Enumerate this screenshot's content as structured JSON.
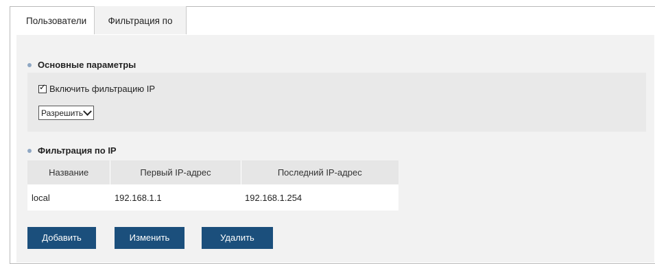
{
  "tabs": [
    {
      "label": "Пользователи"
    },
    {
      "label": "Фильтрация по IP"
    }
  ],
  "basic": {
    "title": "Основные параметры",
    "enable_label": "Включить фильтрацию IP",
    "enable_checked": true,
    "mode_value": "Разрешить"
  },
  "ip_filter": {
    "title": "Фильтрация по IP",
    "columns": [
      "Название",
      "Первый IP-адрес",
      "Последний IP-адрес"
    ],
    "rows": [
      {
        "name": "local",
        "first": "192.168.1.1",
        "last": "192.168.1.254"
      }
    ]
  },
  "buttons": {
    "add": "Добавить",
    "edit": "Изменить",
    "delete": "Удалить"
  },
  "colors": {
    "button": "#1b4f7c",
    "bullet": "#8fa7c3",
    "panel": "#f2f2f2"
  }
}
